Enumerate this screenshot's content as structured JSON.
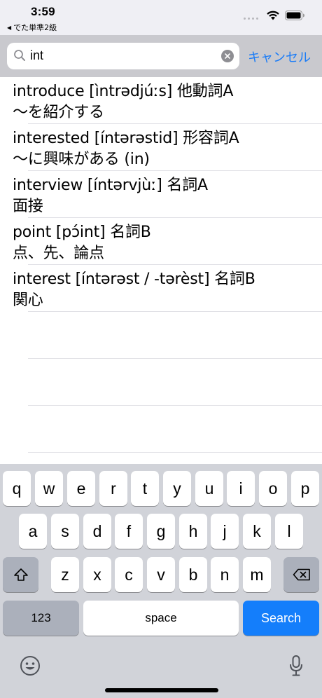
{
  "status_bar": {
    "time": "3:59",
    "back_app_label": "でた単準2級"
  },
  "search": {
    "value": "int",
    "cancel_label": "キャンセル"
  },
  "results": [
    {
      "line1": "introduce [ìntrədjúːs] 他動詞A",
      "line2": "～を紹介する"
    },
    {
      "line1": "interested [íntərəstid] 形容詞A",
      "line2": "～に興味がある (in)"
    },
    {
      "line1": "interview [íntərvjùː] 名詞A",
      "line2": "面接"
    },
    {
      "line1": "point [pɔ́int] 名詞B",
      "line2": "点、先、論点"
    },
    {
      "line1": "interest [íntərəst / -tərèst] 名詞B",
      "line2": "関心"
    }
  ],
  "keyboard": {
    "row1": [
      "q",
      "w",
      "e",
      "r",
      "t",
      "y",
      "u",
      "i",
      "o",
      "p"
    ],
    "row2": [
      "a",
      "s",
      "d",
      "f",
      "g",
      "h",
      "j",
      "k",
      "l"
    ],
    "row3": [
      "z",
      "x",
      "c",
      "v",
      "b",
      "n",
      "m"
    ],
    "numbers_label": "123",
    "space_label": "space",
    "search_label": "Search"
  },
  "colors": {
    "accent": "#1a7cf7",
    "search_key": "#147efb",
    "keyboard_bg": "#d1d3d9"
  }
}
